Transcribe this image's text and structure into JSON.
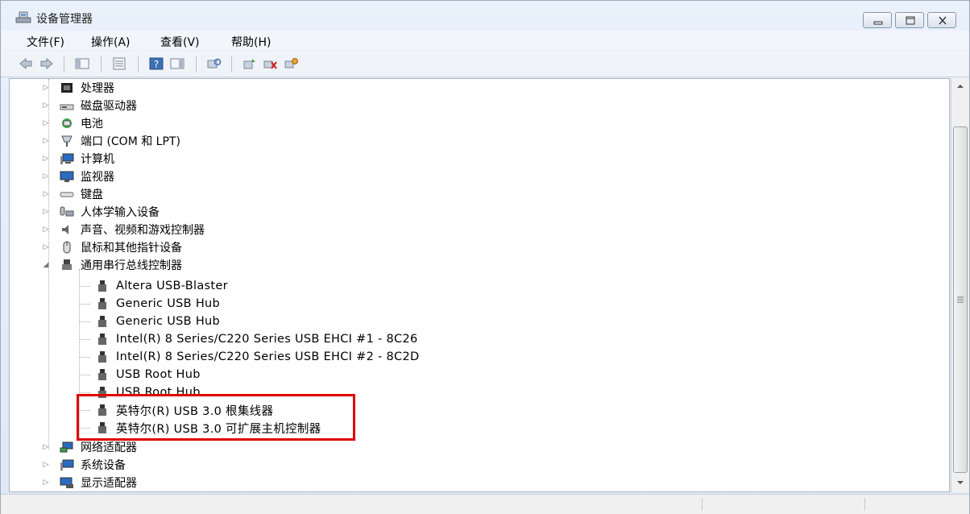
{
  "window": {
    "title": "设备管理器"
  },
  "menu": {
    "items": [
      "文件(F)",
      "操作(A)",
      "查看(V)",
      "帮助(H)"
    ]
  },
  "tree": {
    "categories_top": [
      {
        "label": "处理器",
        "icon": "cpu-icon"
      },
      {
        "label": "磁盘驱动器",
        "icon": "disk-drive-icon"
      },
      {
        "label": "电池",
        "icon": "battery-icon"
      },
      {
        "label": "端口 (COM 和 LPT)",
        "icon": "port-icon"
      },
      {
        "label": "计算机",
        "icon": "computer-icon"
      },
      {
        "label": "监视器",
        "icon": "monitor-icon"
      },
      {
        "label": "键盘",
        "icon": "keyboard-icon"
      },
      {
        "label": "人体学输入设备",
        "icon": "hid-icon"
      },
      {
        "label": "声音、视频和游戏控制器",
        "icon": "sound-icon"
      },
      {
        "label": "鼠标和其他指针设备",
        "icon": "mouse-icon"
      }
    ],
    "usb_category": {
      "label": "通用串行总线控制器",
      "icon": "usb-icon"
    },
    "usb_children": [
      "Altera USB-Blaster",
      "Generic USB Hub",
      "Generic USB Hub",
      "Intel(R) 8 Series/C220 Series USB EHCI #1 - 8C26",
      "Intel(R) 8 Series/C220 Series USB EHCI #2 - 8C2D",
      "USB Root Hub",
      "USB Root Hub",
      "英特尔(R) USB 3.0 根集线器",
      "英特尔(R) USB 3.0 可扩展主机控制器"
    ],
    "categories_bottom": [
      {
        "label": "网络适配器",
        "icon": "network-adapter-icon"
      },
      {
        "label": "系统设备",
        "icon": "system-device-icon"
      },
      {
        "label": "显示适配器",
        "icon": "display-adapter-icon"
      }
    ]
  },
  "colors": {
    "highlight": "#e00000"
  }
}
